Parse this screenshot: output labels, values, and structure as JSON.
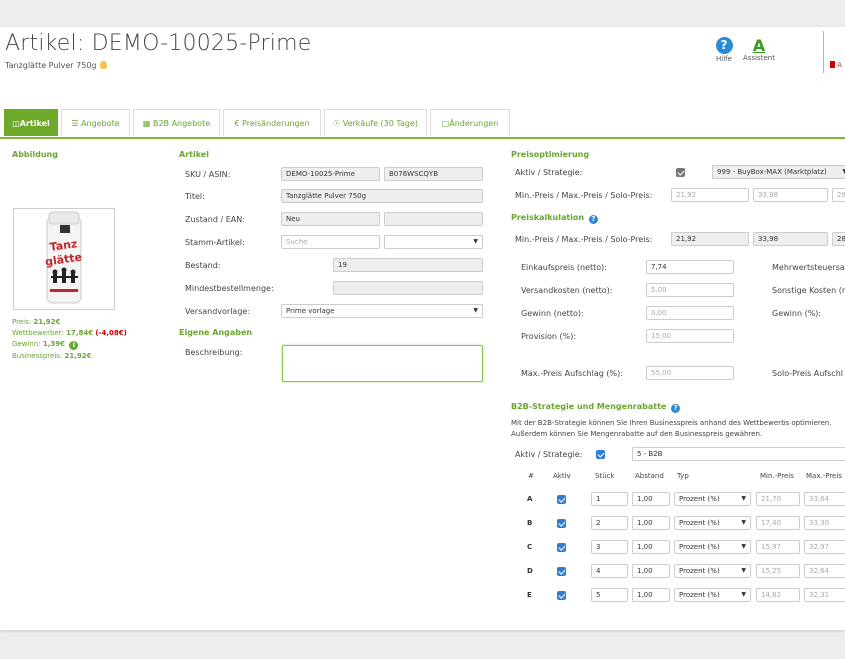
{
  "header": {
    "title": "Artikel: DEMO-10025-Prime",
    "subtitle": "Tanzglätte Pulver 750g",
    "help_label": "Hilfe",
    "assistant_label": "Assistent",
    "right_badge": "A"
  },
  "tabs": [
    {
      "label": "Artikel",
      "icon": "bag-icon"
    },
    {
      "label": "Angebote",
      "icon": "list-icon"
    },
    {
      "label": "B2B Angebote",
      "icon": "briefcase-icon"
    },
    {
      "label": "Preisänderungen",
      "icon": "euro-icon"
    },
    {
      "label": "Verkäufe (30 Tage)",
      "icon": "people-icon"
    },
    {
      "label": "Änderungen",
      "icon": "note-icon"
    }
  ],
  "left": {
    "heading": "Abbildung",
    "image_alt": "Tanzglätte",
    "price_label": "Preis:",
    "price_value": "21,92€",
    "competitor_label": "Wettbewerber:",
    "competitor_value": "17,84€",
    "competitor_diff": "(-4,08€)",
    "profit_label": "Gewinn:",
    "profit_value": "1,39€",
    "business_label": "Businesspreis:",
    "business_value": "21,92€"
  },
  "artikel": {
    "heading": "Artikel",
    "sku_label": "SKU / ASIN:",
    "sku": "DEMO-10025-Prime",
    "asin": "B076WSCQYB",
    "title_label": "Titel:",
    "title": "Tanzglätte Pulver 750g",
    "condition_label": "Zustand / EAN:",
    "condition": "Neu",
    "ean": "",
    "master_label": "Stamm-Artikel:",
    "master_placeholder": "Suche",
    "master_select": "",
    "stock_label": "Bestand:",
    "stock": "19",
    "min_order_label": "Mindestbestellmenge:",
    "min_order": "",
    "shipping_label": "Versandvorlage:",
    "shipping": "Prime vorlage",
    "own_heading": "Eigene Angaben",
    "desc_label": "Beschreibung:"
  },
  "preisopt": {
    "heading": "Preisoptimierung",
    "active_label": "Aktiv / Strategie:",
    "strategy": "999 - BuyBox-MAX (Marktplatz)",
    "minmax_label": "Min.-Preis / Max.-Preis / Solo-Preis:",
    "min": "21,92",
    "max": "33,98",
    "solo": "28"
  },
  "preiskalk": {
    "heading": "Preiskalkulation",
    "minmax_label": "Min.-Preis / Max.-Preis / Solo-Preis:",
    "min": "21,92",
    "max": "33,98",
    "solo": "28",
    "ek_label": "Einkaufspreis (netto):",
    "ek": "7,74",
    "mwst_label": "Mehrwertsteuersa",
    "versand_label": "Versandkosten (netto):",
    "versand": "5,00",
    "sonstige_label": "Sonstige Kosten (n",
    "gewinn_label": "Gewinn (netto):",
    "gewinn": "0,00",
    "gewinn_pct_label": "Gewinn (%):",
    "provision_label": "Provision (%):",
    "provision": "15,00",
    "maxaufschlag_label": "Max.-Preis Aufschlag (%):",
    "maxaufschlag": "55,00",
    "soloaufschlag_label": "Solo-Preis Aufschl"
  },
  "b2b": {
    "heading": "B2B-Strategie und Mengenrabatte",
    "desc1": "Mit der B2B-Strategie können Sie Ihren Businesspreis anhand des Wettbewerbs optimieren.",
    "desc2": "Außerdem können Sie Mengenrabatte auf den Businesspreis gewähren.",
    "active_label": "Aktiv / Strategie:",
    "strategy": "5 - B2B",
    "columns": [
      "#",
      "Aktiv",
      "Stück",
      "Abstand",
      "Typ",
      "Min.-Preis",
      "Max.-Preis"
    ],
    "rows": [
      {
        "key": "A",
        "qty": "1",
        "dist": "1,00",
        "type": "Prozent (%)",
        "min": "21,70",
        "max": "33,64"
      },
      {
        "key": "B",
        "qty": "2",
        "dist": "1,00",
        "type": "Prozent (%)",
        "min": "17,40",
        "max": "33,30"
      },
      {
        "key": "C",
        "qty": "3",
        "dist": "1,00",
        "type": "Prozent (%)",
        "min": "15,97",
        "max": "32,97"
      },
      {
        "key": "D",
        "qty": "4",
        "dist": "1,00",
        "type": "Prozent (%)",
        "min": "15,25",
        "max": "32,64"
      },
      {
        "key": "E",
        "qty": "5",
        "dist": "1,00",
        "type": "Prozent (%)",
        "min": "14,82",
        "max": "32,31"
      }
    ]
  },
  "colors": {
    "accent": "#6fa92c",
    "link": "#2a8bd4",
    "danger": "#cc0000"
  }
}
